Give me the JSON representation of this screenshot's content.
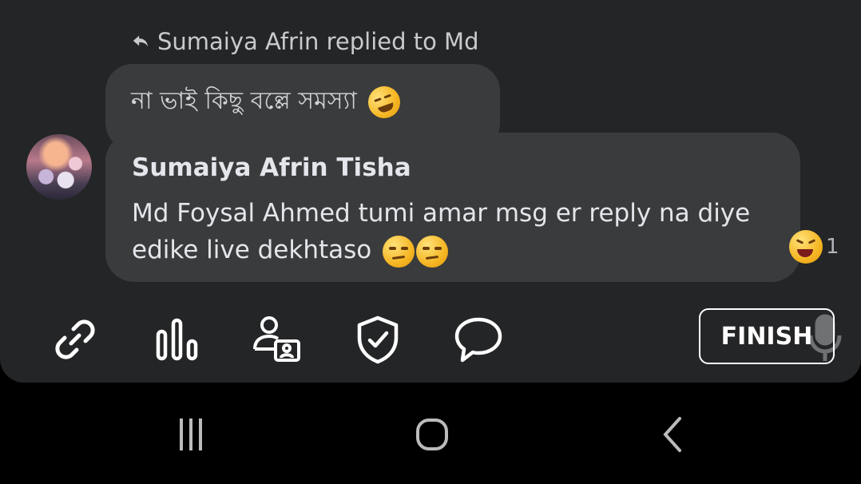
{
  "reply_context": {
    "icon": "reply-arrow-icon",
    "text": "Sumaiya Afrin replied to Md"
  },
  "quoted_message": {
    "text": "না ভাই কিছু বল্লে সমস্যা",
    "emoji": "rolling-on-floor-laughing"
  },
  "message": {
    "sender": "Sumaiya Afrin Tisha",
    "text": "Md Foysal Ahmed tumi amar msg er reply na diye edike live dekhtaso",
    "emojis": [
      "unamused",
      "unamused"
    ],
    "reaction": {
      "emoji": "laughing",
      "count": "1"
    }
  },
  "toolbar": {
    "tools": [
      {
        "name": "link-icon"
      },
      {
        "name": "poll-icon"
      },
      {
        "name": "guest-icon"
      },
      {
        "name": "moderation-shield-icon"
      },
      {
        "name": "comments-icon"
      }
    ],
    "finish_label": "FINISH"
  },
  "navbar": {
    "buttons": [
      {
        "name": "recent-apps-icon"
      },
      {
        "name": "home-icon"
      },
      {
        "name": "back-icon"
      }
    ]
  }
}
